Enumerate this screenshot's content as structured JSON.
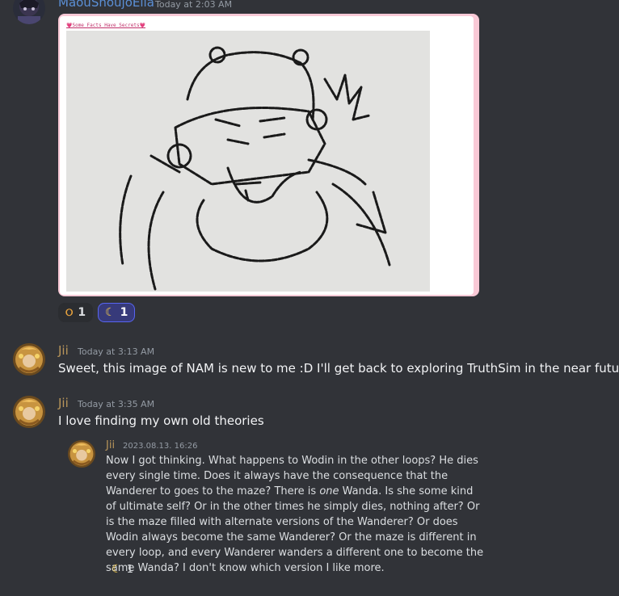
{
  "messages": [
    {
      "username": "MaouShoujoElla",
      "username_color": "#5b8fd6",
      "timestamp": "Today at 2:03 AM",
      "embed_caption": "💗Some Facts Have Secrets💗",
      "reactions": [
        {
          "emoji": "ghost-eyes-emoji",
          "glyph": "ଠ",
          "count": "1",
          "active": false
        },
        {
          "emoji": "crescent-moon-emoji",
          "glyph": "☾",
          "count": "1",
          "active": true
        }
      ]
    },
    {
      "username": "Jii",
      "username_color": "#b8955a",
      "timestamp": "Today at 3:13 AM",
      "text": "Sweet, this image of NAM is new to me :D I'll get back to exploring TruthSim in the near future"
    },
    {
      "username": "Jii",
      "username_color": "#b8955a",
      "timestamp": "Today at 3:35 AM",
      "text": "I love finding my own old theories"
    }
  ],
  "quoted": {
    "username": "Jii",
    "timestamp": "2023.08.13. 16:26",
    "text_before_em": "Now I got thinking. What happens to Wodin in the other loops? He dies every single time. Does it always have the consequence that the Wanderer to goes to the maze? There is ",
    "text_em": "one",
    "text_after_em": " Wanda. Is she some kind of ultimate self? Or in the other times he simply dies, nothing after? Or is the maze filled with alternate versions of the Wanderer? Or does Wodin always become the same Wanderer? Or the maze is different in every loop, and every Wanderer wanders a different one to become the same Wanda? I don't know which version I like more.",
    "reaction": {
      "emoji": "crescent-moon-emoji",
      "glyph": "☾",
      "count": "1"
    }
  }
}
